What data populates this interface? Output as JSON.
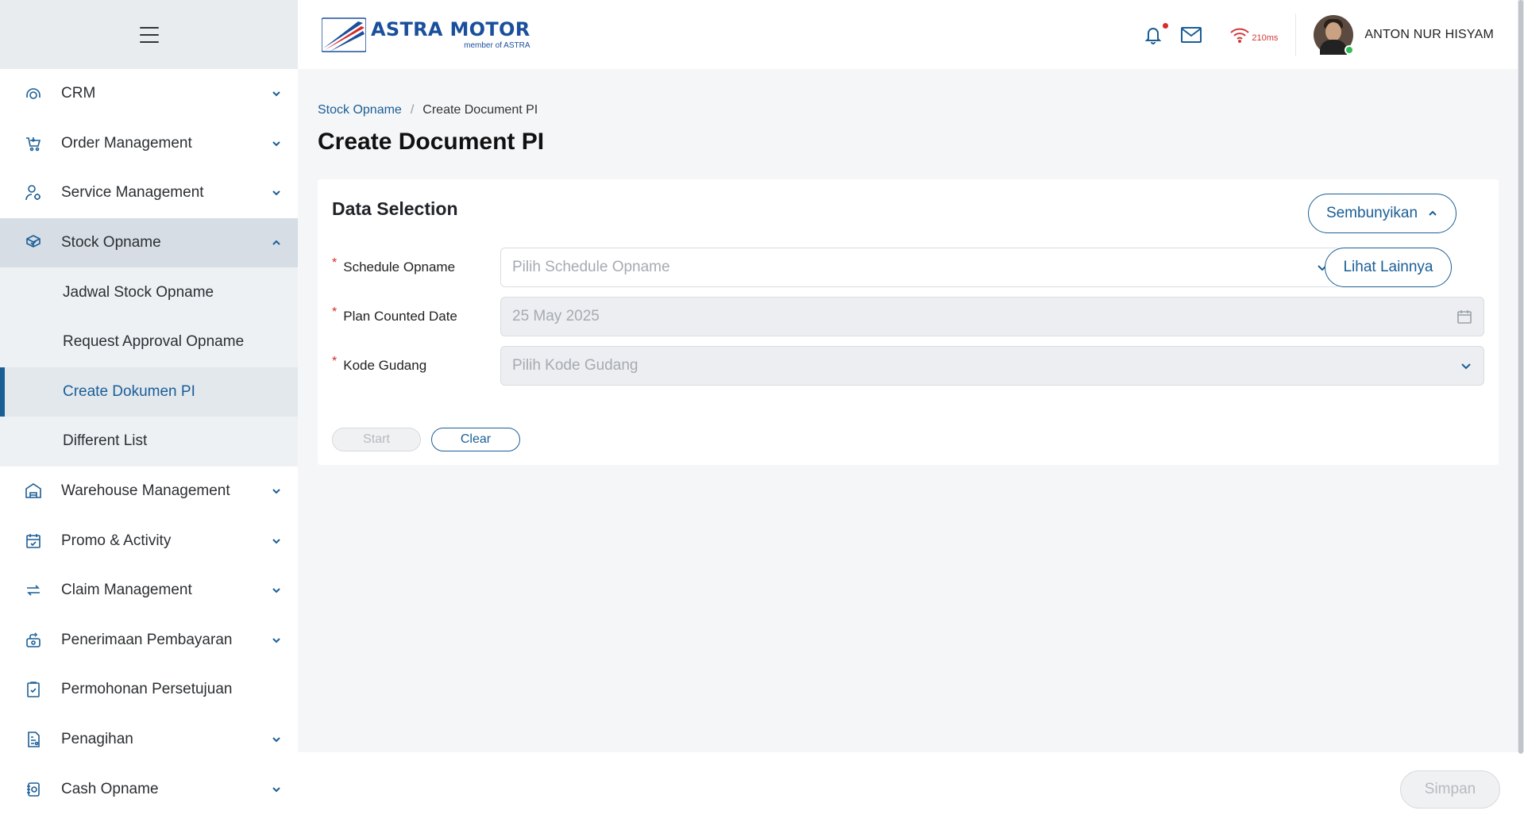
{
  "sidebar": {
    "items": [
      {
        "label": "CRM",
        "icon": "crm-icon"
      },
      {
        "label": "Order Management",
        "icon": "cart-icon"
      },
      {
        "label": "Service Management",
        "icon": "service-person-icon"
      },
      {
        "label": "Stock Opname",
        "icon": "box-check-icon",
        "expanded": true
      },
      {
        "label": "Warehouse Management",
        "icon": "warehouse-icon"
      },
      {
        "label": "Promo & Activity",
        "icon": "calendar-icon"
      },
      {
        "label": "Claim Management",
        "icon": "claim-arrows-icon"
      },
      {
        "label": "Penerimaan Pembayaran",
        "icon": "payment-icon"
      },
      {
        "label": "Permohonan Persetujuan",
        "icon": "clipboard-check-icon"
      },
      {
        "label": "Penagihan",
        "icon": "invoice-icon"
      },
      {
        "label": "Cash Opname",
        "icon": "cash-icon"
      }
    ],
    "stock_opname_sub": [
      {
        "label": "Jadwal Stock Opname"
      },
      {
        "label": "Request Approval Opname"
      },
      {
        "label": "Create Dokumen PI",
        "active": true
      },
      {
        "label": "Different List"
      }
    ]
  },
  "header": {
    "logo_main": "ASTRA MOTOR",
    "logo_sub": "member of ASTRA",
    "signal_latency": "210ms",
    "user_name": "ANTON NUR HISYAM",
    "notification_dot_color": "#d72a2a"
  },
  "breadcrumb": {
    "parent": "Stock Opname",
    "separator": "/",
    "current": "Create Document PI"
  },
  "page": {
    "title": "Create Document PI"
  },
  "card": {
    "title": "Data Selection",
    "hide_button": "Sembunyikan",
    "more_button": "Lihat Lainnya",
    "fields": {
      "schedule_label": "Schedule Opname",
      "schedule_placeholder": "Pilih Schedule Opname",
      "plan_date_label": "Plan Counted Date",
      "plan_date_value": "25 May 2025",
      "warehouse_label": "Kode Gudang",
      "warehouse_placeholder": "Pilih Kode Gudang",
      "required_mark": "*"
    },
    "start_button": "Start",
    "clear_button": "Clear"
  },
  "footer": {
    "save_button": "Simpan"
  },
  "colors": {
    "accent": "#1a5e96",
    "brand": "#1a4f9c",
    "required": "#d72a2a",
    "online": "#2fbf56"
  }
}
